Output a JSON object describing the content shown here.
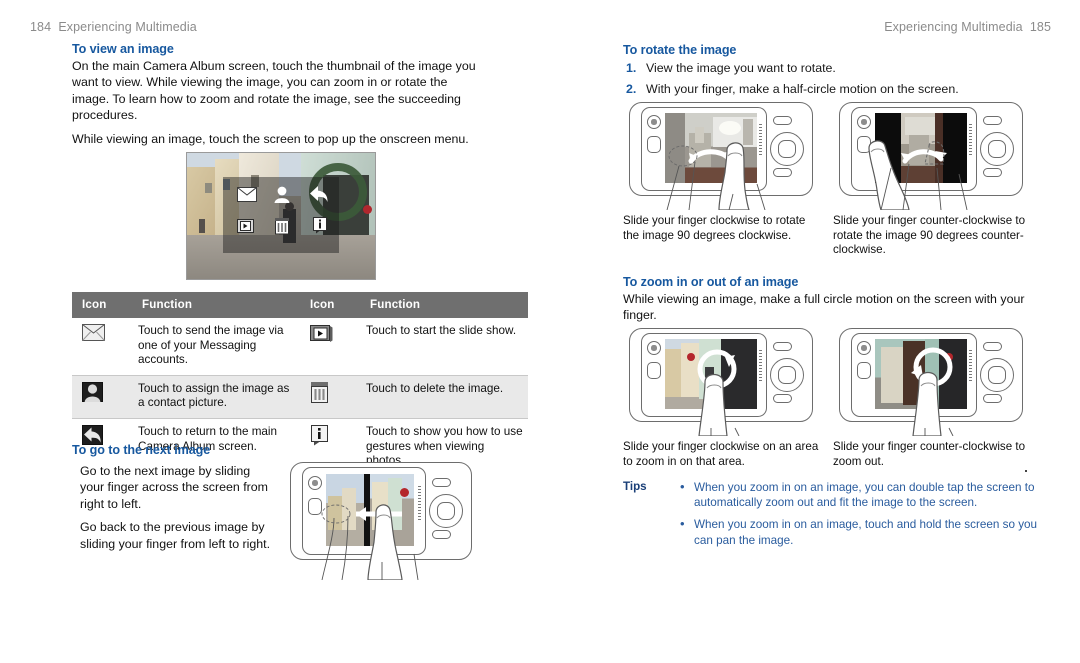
{
  "left_page": {
    "folio": {
      "number": "184",
      "title": "Experiencing Multimedia"
    },
    "section_view": {
      "heading": "To view an image",
      "paragraph1": "On the main Camera Album screen, touch the thumbnail of the image you want to view. While viewing the image, you can zoom in or rotate the image. To learn how to zoom and rotate the image, see the succeeding procedures.",
      "paragraph2": "While viewing an image, touch the screen to pop up the onscreen menu."
    },
    "table": {
      "headers": [
        "Icon",
        "Function",
        "Icon",
        "Function"
      ],
      "rows": [
        {
          "icon_left": "envelope-icon",
          "function_left": "Touch to send the image via one of your Messaging accounts.",
          "icon_right": "slideshow-icon",
          "function_right": "Touch to start the slide show."
        },
        {
          "icon_left": "contact-person-icon",
          "function_left": "Touch to assign the image as a contact picture.",
          "icon_right": "trash-icon",
          "function_right": "Touch to delete the image."
        },
        {
          "icon_left": "back-arrow-icon",
          "function_left": "Touch to return to the main Camera Album screen.",
          "icon_right": "info-icon",
          "function_right": "Touch to show you how to use gestures when viewing photos."
        }
      ]
    },
    "section_next": {
      "heading": "To go to the next image",
      "paragraph1": "Go to the next image by sliding your finger across the screen from right to left.",
      "paragraph2": "Go back to the previous image by sliding your finger from left to right."
    }
  },
  "right_page": {
    "folio": {
      "number": "185",
      "title": "Experiencing Multimedia"
    },
    "section_rotate": {
      "heading": "To rotate the image",
      "steps": [
        {
          "number": "1.",
          "text": "View the image you want to rotate."
        },
        {
          "number": "2.",
          "text": "With your finger, make a half-circle motion on the screen."
        }
      ],
      "caption_left": "Slide your finger clockwise to rotate the image 90 degrees clockwise.",
      "caption_right": "Slide your finger counter-clockwise to rotate the image 90 degrees counter-clockwise."
    },
    "section_zoom": {
      "heading": "To zoom in or out of an image",
      "paragraph": "While viewing an image, make a full circle motion on the screen with your finger.",
      "caption_left": "Slide your finger clockwise on an area to zoom in on that area.",
      "caption_right": "Slide your finger counter-clockwise to zoom out."
    },
    "tips": {
      "label": "Tips",
      "bullet": "•",
      "items": [
        "When you zoom in on an image, you can double tap the screen to automatically zoom out and fit the image to the screen.",
        "When you zoom in on an image, touch and hold the screen so you can pan the image."
      ]
    }
  },
  "colors": {
    "heading_blue": "#17589f",
    "tips_blue": "#2a5c9e",
    "table_header_gray": "#6f6f6f",
    "table_alt_row": "#e9e9e9",
    "folio_gray": "#8b8b8b"
  }
}
